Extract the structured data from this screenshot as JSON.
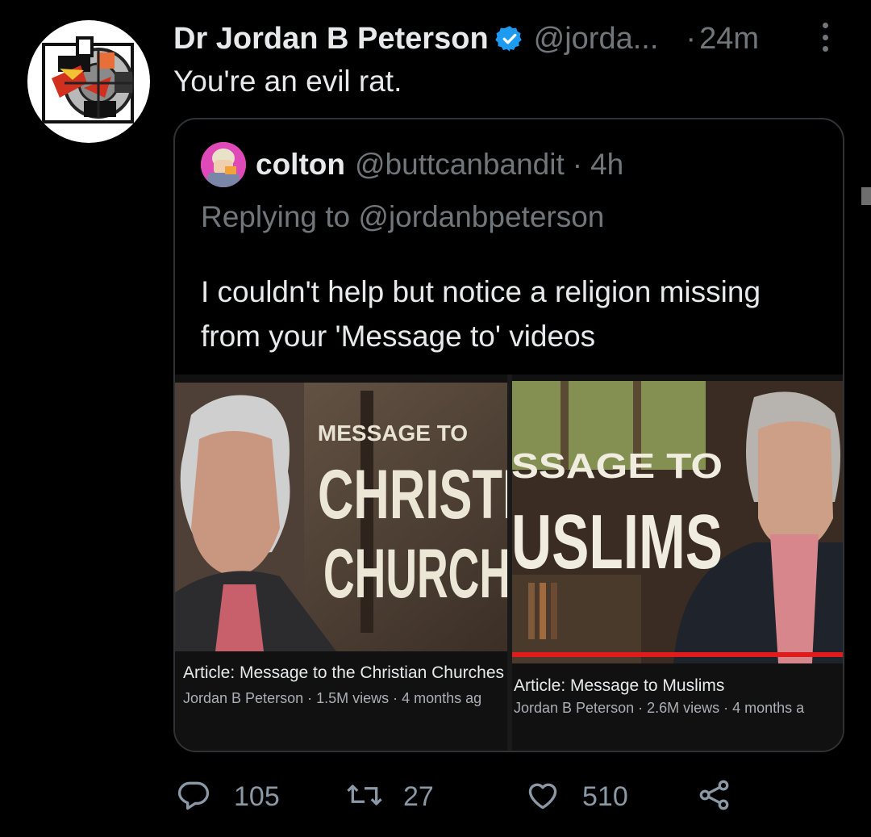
{
  "tweet": {
    "author_name": "Dr Jordan B Peterson",
    "author_handle": "@jorda...",
    "separator": "·",
    "timestamp": "24m",
    "verified_icon": "verified-badge-icon",
    "text": "You're an evil rat."
  },
  "quoted": {
    "author_name": "colton",
    "author_handle": "@buttcanbandit",
    "separator": "·",
    "timestamp": "4h",
    "replying_prefix": "Replying to",
    "replying_to": "@jordanbpeterson",
    "text": "I couldn't help but notice a religion missing from your 'Message to' videos",
    "videos": [
      {
        "thumb_line1": "MESSAGE TO",
        "thumb_line2": "CHRISTI",
        "thumb_line3": "CHURCH",
        "title": "Article: Message to the Christian Churches",
        "meta": "Jordan B Peterson · 1.5M views · 4 months ag"
      },
      {
        "thumb_line1": "SSAGE TO",
        "thumb_line2": "USLIMS",
        "title": "Article: Message to Muslims",
        "meta": "Jordan B Peterson · 2.6M views · 4 months a",
        "progress": 1.0
      }
    ]
  },
  "actions": {
    "reply_count": "105",
    "retweet_count": "27",
    "like_count": "510",
    "icons": [
      "reply-icon",
      "retweet-icon",
      "like-icon",
      "share-icon"
    ]
  },
  "colors": {
    "background": "#000000",
    "primary_text": "#e7e9ea",
    "secondary_text": "#71767b",
    "verified_blue": "#1d9bf0",
    "progress_red": "#e01b1b"
  }
}
